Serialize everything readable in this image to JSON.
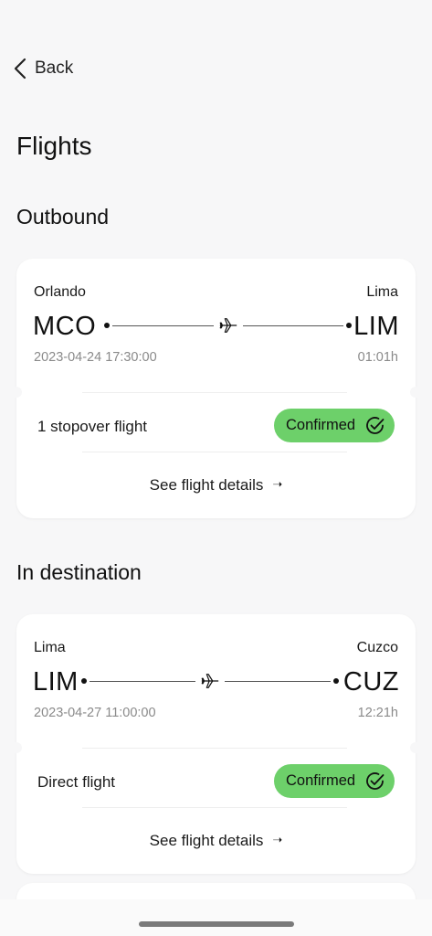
{
  "nav": {
    "back_label": "Back"
  },
  "page": {
    "title": "Flights"
  },
  "sections": [
    {
      "title": "Outbound",
      "flight": {
        "origin_city": "Orlando",
        "destination_city": "Lima",
        "origin_code": "MCO",
        "destination_code": "LIM",
        "departure": "2023-04-24 17:30:00",
        "duration": "01:01h",
        "stop_info": "1 stopover flight",
        "status": "Confirmed",
        "details_label": "See flight details"
      }
    },
    {
      "title": "In destination",
      "flight": {
        "origin_city": "Lima",
        "destination_city": "Cuzco",
        "origin_code": "LIM",
        "destination_code": "CUZ",
        "departure": "2023-04-27 11:00:00",
        "duration": "12:21h",
        "stop_info": "Direct flight",
        "status": "Confirmed",
        "details_label": "See flight details"
      }
    }
  ],
  "colors": {
    "background": "#f7f7f8",
    "card": "#ffffff",
    "confirmed": "#6dd06a",
    "muted_text": "#8a8a8a"
  },
  "icons": {
    "back": "chevron-left-icon",
    "plane": "airplane-icon",
    "check": "check-circle-icon",
    "arrow": "arrow-right-icon"
  }
}
